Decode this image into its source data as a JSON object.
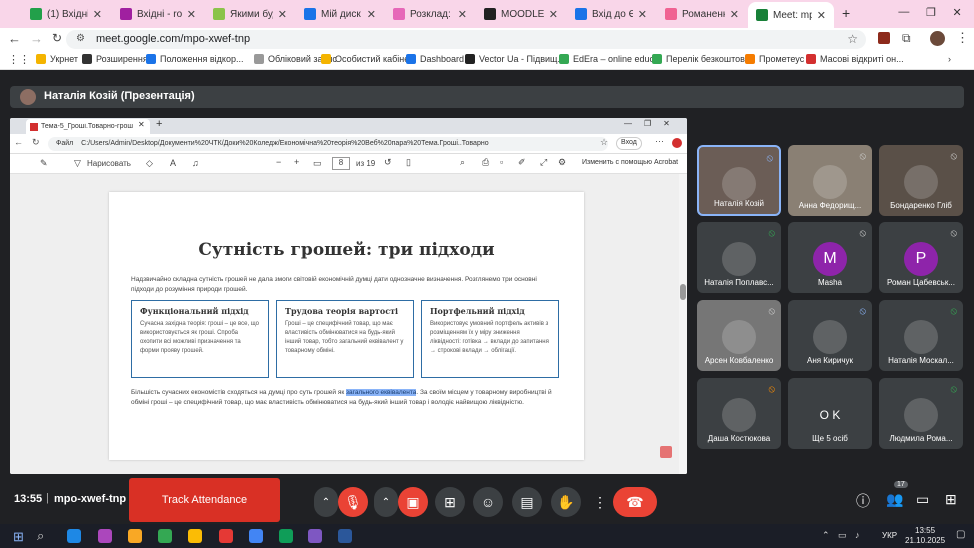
{
  "browser": {
    "tabs": [
      {
        "label": "(1) Вхідні • iRei",
        "color": "#22a04a"
      },
      {
        "label": "Вхідні - romar",
        "color": "#a020a0"
      },
      {
        "label": "Якими будуть",
        "color": "#8bc34a"
      },
      {
        "label": "Мій диск – G",
        "color": "#1a73e8"
      },
      {
        "label": "Розклад: Викл",
        "color": "#e667b8"
      },
      {
        "label": "MOODLE – ДЕ",
        "color": "#222222"
      },
      {
        "label": "Вхід до ЄАС",
        "color": "#1a73e8"
      },
      {
        "label": "Романенко Л.",
        "color": "#f06292"
      },
      {
        "label": "Meet: mp",
        "color": "#188038"
      }
    ],
    "url": "meet.google.com/mpo-xwef-tnp",
    "bookmarks": [
      {
        "label": "Укрнет",
        "color": "#f4b400"
      },
      {
        "label": "Розширення",
        "color": "#333333"
      },
      {
        "label": "Положення відкор...",
        "color": "#1a73e8"
      },
      {
        "label": "Обліковий запис",
        "color": "#999999"
      },
      {
        "label": "Особистий кабінет",
        "color": "#f4b400"
      },
      {
        "label": "Dashboard",
        "color": "#1a73e8"
      },
      {
        "label": "Vector Ua - Підвищ...",
        "color": "#222222"
      },
      {
        "label": "EdEra – online educ...",
        "color": "#34a853"
      },
      {
        "label": "Перелік безкоштов...",
        "color": "#34a853"
      },
      {
        "label": "Прометеус",
        "color": "#f57c00"
      },
      {
        "label": "Масові відкриті он...",
        "color": "#d32f2f"
      }
    ]
  },
  "meet": {
    "presenter_label": "Наталія Козій (Презентація)",
    "time": "13:55",
    "meeting_code": "mpo-xwef-tnp",
    "track_attendance_label": "Track Attendance",
    "participants_count": "17",
    "participants": [
      {
        "name": "Наталія Козій",
        "bg": "#6b5d56",
        "initial": ""
      },
      {
        "name": "Анна Федорищ...",
        "bg": "#8a8074",
        "initial": ""
      },
      {
        "name": "Бондаренко Гліб",
        "bg": "#5a5048",
        "initial": ""
      },
      {
        "name": "Наталія Поплавс...",
        "bg": "#3c4043",
        "initial": ""
      },
      {
        "name": "Masha",
        "bg": "#3c4043",
        "initial": "M",
        "avatar_bg": "#8e24aa"
      },
      {
        "name": "Роман Цабевськ...",
        "bg": "#3c4043",
        "initial": "P",
        "avatar_bg": "#8e24aa"
      },
      {
        "name": "Арсен Ковбаленко",
        "bg": "#767676",
        "initial": ""
      },
      {
        "name": "Аня Киричук",
        "bg": "#3c4043",
        "initial": ""
      },
      {
        "name": "Наталія Москал...",
        "bg": "#3c4043",
        "initial": ""
      },
      {
        "name": "Даша Костюкова",
        "bg": "#3c4043",
        "initial": ""
      },
      {
        "name": "Ще 5 осіб",
        "bg": "#3c4043",
        "initial": "O K"
      },
      {
        "name": "Людмила Рома...",
        "bg": "#3c4043",
        "initial": ""
      }
    ]
  },
  "pdf": {
    "tab_title": "Тема-5_Гроші.Товарно-грош",
    "path_prefix": "Файл",
    "path": "C:/Users/Admin/Desktop/Документи%20ЧТК/Доки%20Коледж/Економічна%20теорія%20Веб%20пара%20Тема.Гроші..Товарно",
    "draw_label": "Нарисовать",
    "page_current": "8",
    "page_total": "из 19",
    "sign_in_label": "Вход",
    "edit_label": "Изменить с помощью Acrobat",
    "slide": {
      "title": "Сутність грошей: три підходи",
      "intro": "Надзвичайно складна сутність грошей не дала змоги світовій економічній думці дати однозначне визначення. Розглянемо три основні підходи до розуміння природи грошей.",
      "cards": [
        {
          "title": "Функціональний підхід",
          "text": "Сучасна західна теорія: гроші – це все, що використовується як гроші. Спроба охопити всі можливі призначення та форми прояву грошей."
        },
        {
          "title": "Трудова теорія вартості",
          "text": "Гроші – це специфічний товар, що має властивість обмінюватися на будь-який інший товар, тобто загальний еквівалент у товарному обміні."
        },
        {
          "title": "Портфельний підхід",
          "text": "Використовує умовний портфель активів з розміщенням їх у міру зниження ліквідності: готівка → вклади до запитання → строкові вклади → облігації."
        }
      ],
      "conclusion_before": "Більшість сучасних економістів сходяться на думці про суть грошей як ",
      "conclusion_highlight": "загального еквівалента",
      "conclusion_after": ". За своїм місцем у товарному виробництві й обміні гроші – це специфічний товар, що має властивість обмінюватися на будь-який інший товар і володіє найвищою ліквідністю."
    }
  },
  "taskbar": {
    "lang": "УКР",
    "time": "13:55",
    "date": "21.10.2025"
  }
}
